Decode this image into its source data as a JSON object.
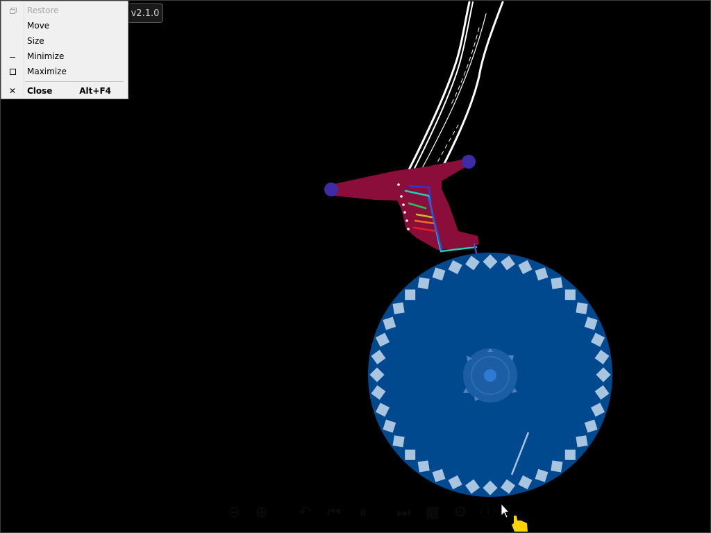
{
  "app": {
    "version": "v2.1.0"
  },
  "system_menu": {
    "items": [
      {
        "label": "Restore",
        "accel": "",
        "icon": "restore-icon",
        "enabled": false
      },
      {
        "label": "Move",
        "accel": "",
        "icon": "",
        "enabled": true
      },
      {
        "label": "Size",
        "accel": "",
        "icon": "",
        "enabled": true
      },
      {
        "label": "Minimize",
        "accel": "",
        "icon": "minimize-icon",
        "enabled": true
      },
      {
        "label": "Maximize",
        "accel": "",
        "icon": "maximize-icon",
        "enabled": true
      },
      {
        "label": "Close",
        "accel": "Alt+F4",
        "icon": "close-icon",
        "enabled": true
      }
    ]
  },
  "toolbar": {
    "buttons": [
      "zoom-out-icon",
      "zoom-in-icon",
      "undo-icon",
      "step-back-icon",
      "pause-icon",
      "step-forward-icon",
      "grid-icon",
      "settings-icon",
      "info-icon"
    ]
  },
  "scene": {
    "wheel_color": "#00498f",
    "wheel_tooth_color": "#a9c4de",
    "wheel_tooth_count": 40,
    "hub_color": "#2f7ad6",
    "lever_color": "#8b0e3a",
    "pivot_color": "#3d2ca5",
    "trace_color": "#ffffff",
    "cursor_color": "#ffd400"
  }
}
